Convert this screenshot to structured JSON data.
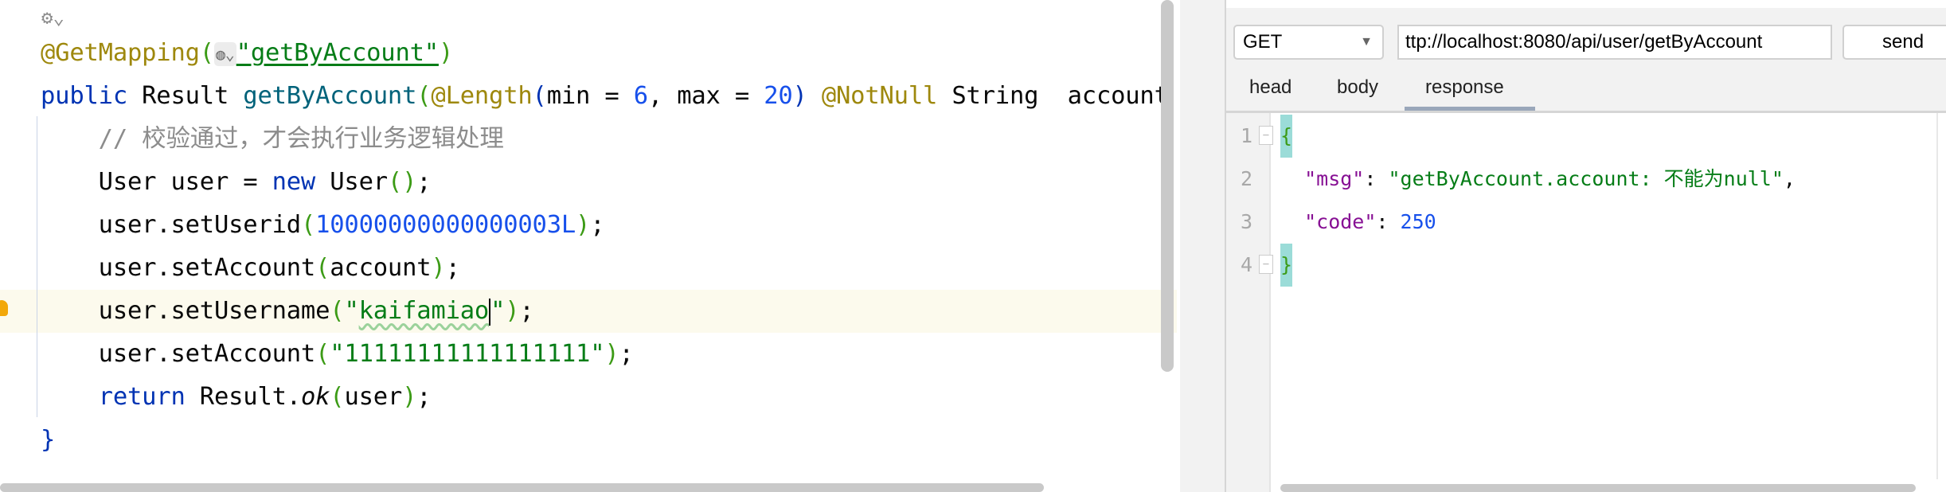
{
  "colors": {
    "annotation": "#9e880d",
    "keyword": "#0033b3",
    "method": "#00627a",
    "string": "#067d17",
    "number": "#1750eb",
    "comment": "#8c8c8c",
    "bracket": "#3c9b16",
    "plain": "#080808",
    "json_key": "#871094",
    "current_line": "#fcfaed"
  },
  "editor": {
    "top_icons": "⚙⌄",
    "inlay_icon": "globe-icon",
    "lines": [
      [
        {
          "t": "@GetMapping",
          "c": "annotation"
        },
        {
          "t": "(",
          "c": "bracket"
        },
        {
          "t": "INLAY",
          "c": "inlay"
        },
        {
          "t": "\"getByAccount\"",
          "c": "string"
        },
        {
          "t": ")",
          "c": "bracket"
        }
      ],
      [
        {
          "t": "public ",
          "c": "keyword"
        },
        {
          "t": "Result ",
          "c": "plain"
        },
        {
          "t": "getByAccount",
          "c": "method"
        },
        {
          "t": "(",
          "c": "bracket"
        },
        {
          "t": "@Length",
          "c": "annotation"
        },
        {
          "t": "(",
          "c": "keyword"
        },
        {
          "t": "min = ",
          "c": "plain"
        },
        {
          "t": "6",
          "c": "number"
        },
        {
          "t": ", max = ",
          "c": "plain"
        },
        {
          "t": "20",
          "c": "number"
        },
        {
          "t": ") ",
          "c": "keyword"
        },
        {
          "t": "@NotNull ",
          "c": "annotation"
        },
        {
          "t": "String  account",
          "c": "plain"
        }
      ],
      [
        {
          "t": "    // 校验通过，才会执行业务逻辑处理",
          "c": "comment"
        }
      ],
      [
        {
          "t": "    User user = ",
          "c": "plain"
        },
        {
          "t": "new ",
          "c": "keyword"
        },
        {
          "t": "User",
          "c": "plain"
        },
        {
          "t": "()",
          "c": "bracket"
        },
        {
          "t": ";",
          "c": "plain"
        }
      ],
      [
        {
          "t": "    user.setUserid",
          "c": "plain"
        },
        {
          "t": "(",
          "c": "bracket"
        },
        {
          "t": "10000000000000003L",
          "c": "number"
        },
        {
          "t": ")",
          "c": "bracket"
        },
        {
          "t": ";",
          "c": "plain"
        }
      ],
      [
        {
          "t": "    user.setAccount",
          "c": "plain"
        },
        {
          "t": "(",
          "c": "bracket"
        },
        {
          "t": "account",
          "c": "plain"
        },
        {
          "t": ")",
          "c": "bracket"
        },
        {
          "t": ";",
          "c": "plain"
        }
      ],
      [
        {
          "t": "    user.setUsername",
          "c": "plain"
        },
        {
          "t": "(",
          "c": "bracket"
        },
        {
          "t": "\"",
          "c": "string"
        },
        {
          "t": "kaifamiao",
          "c": "squig"
        },
        {
          "t": "CARET",
          "c": "caret"
        },
        {
          "t": "\"",
          "c": "string"
        },
        {
          "t": ")",
          "c": "bracket"
        },
        {
          "t": ";",
          "c": "plain"
        }
      ],
      [
        {
          "t": "    user.setAccount",
          "c": "plain"
        },
        {
          "t": "(",
          "c": "bracket"
        },
        {
          "t": "\"11111111111111111\"",
          "c": "string"
        },
        {
          "t": ")",
          "c": "bracket"
        },
        {
          "t": ";",
          "c": "plain"
        }
      ],
      [
        {
          "t": "    return ",
          "c": "keyword"
        },
        {
          "t": "Result.",
          "c": "plain"
        },
        {
          "t": "ok",
          "c": "italic"
        },
        {
          "t": "(",
          "c": "bracket"
        },
        {
          "t": "user",
          "c": "plain"
        },
        {
          "t": ")",
          "c": "bracket"
        },
        {
          "t": ";",
          "c": "plain"
        }
      ],
      [
        {
          "t": "}",
          "c": "keyword"
        }
      ]
    ]
  },
  "request": {
    "method": "GET",
    "url": "ttp://localhost:8080/api/user/getByAccount",
    "send_label": "send",
    "tabs": [
      "head",
      "body",
      "response"
    ],
    "active_tab": "response"
  },
  "response": {
    "line_numbers": [
      "1",
      "2",
      "3",
      "4"
    ],
    "lines": [
      [
        {
          "t": "{",
          "c": "bracket",
          "hl": true
        }
      ],
      [
        {
          "t": "  \"msg\"",
          "c": "json_key"
        },
        {
          "t": ": ",
          "c": "plain"
        },
        {
          "t": "\"getByAccount.account: 不能为null\"",
          "c": "string"
        },
        {
          "t": ",",
          "c": "plain"
        }
      ],
      [
        {
          "t": "  \"code\"",
          "c": "json_key"
        },
        {
          "t": ": ",
          "c": "plain"
        },
        {
          "t": "250",
          "c": "number"
        }
      ],
      [
        {
          "t": "}",
          "c": "bracket",
          "hl": true
        }
      ]
    ]
  }
}
